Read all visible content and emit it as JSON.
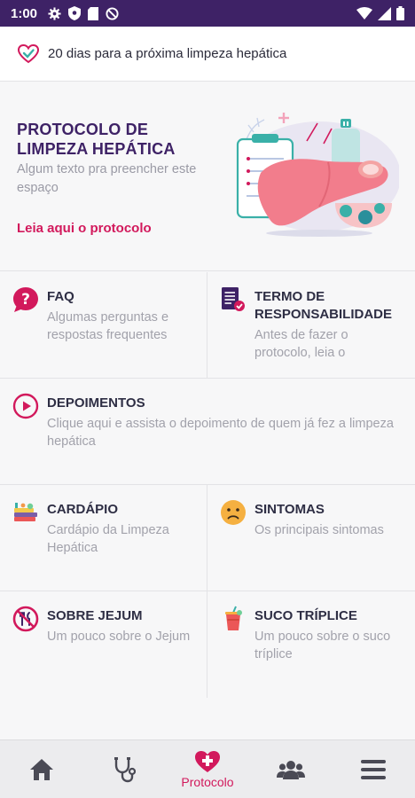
{
  "status": {
    "time": "1:00"
  },
  "banner": {
    "text": "20 dias para a próxima limpeza hepática"
  },
  "hero": {
    "title": "PROTOCOLO DE LIMPEZA HEPÁTICA",
    "description": "Algum texto pra preencher este espaço",
    "link": "Leia aqui o protocolo"
  },
  "cards": {
    "faq": {
      "title": "FAQ",
      "subtitle": "Algumas perguntas e respostas frequentes"
    },
    "termo": {
      "title": "TERMO DE RESPONSABILIDADE",
      "subtitle": "Antes de fazer o protocolo, leia o"
    },
    "depoimentos": {
      "title": "DEPOIMENTOS",
      "subtitle": "Clique aqui e assista o depoimento de quem já fez a limpeza hepática"
    },
    "cardapio": {
      "title": "CARDÁPIO",
      "subtitle": "Cardápio da Limpeza Hepática"
    },
    "sintomas": {
      "title": "SINTOMAS",
      "subtitle": "Os principais sintomas"
    },
    "jejum": {
      "title": "SOBRE JEJUM",
      "subtitle": "Um pouco sobre o Jejum"
    },
    "suco": {
      "title": "SUCO TRÍPLICE",
      "subtitle": "Um pouco sobre o suco tríplice"
    }
  },
  "tabbar": {
    "active_label": "Protocolo",
    "tabs": [
      "home-icon",
      "stethoscope-icon",
      "medical-heart-icon",
      "group-icon",
      "menu-icon"
    ]
  },
  "colors": {
    "brand": "#3e2266",
    "accent": "#d2195c"
  }
}
